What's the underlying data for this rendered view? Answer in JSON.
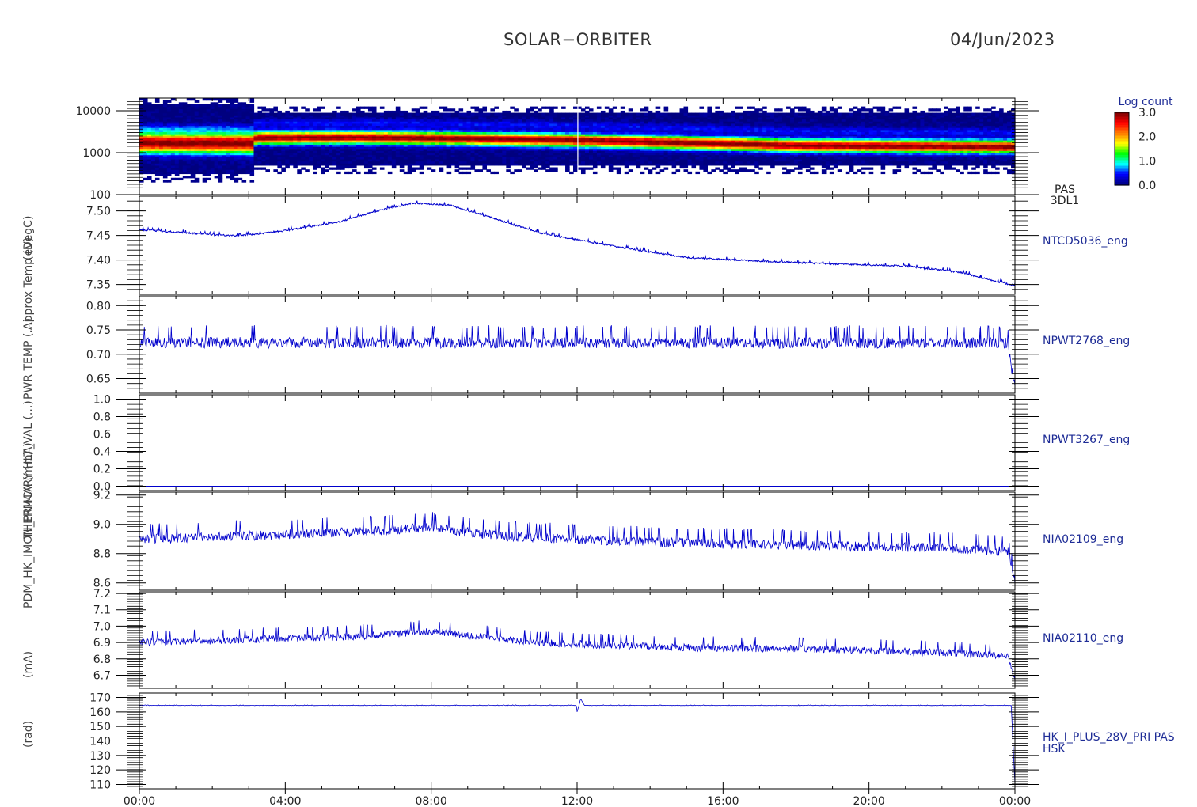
{
  "header": {
    "title": "SOLAR−ORBITER",
    "date": "04/Jun/2023"
  },
  "colors": {
    "series": "#0000cc",
    "axis": "#000000",
    "label": "#1e2c96",
    "colorbar": [
      "#00007f",
      "#0000ff",
      "#00ffff",
      "#00ff00",
      "#ffff00",
      "#ff8000",
      "#ff0000",
      "#7f0000"
    ]
  },
  "x_axis": {
    "ticks": [
      "00:00",
      "04:00",
      "08:00",
      "12:00",
      "16:00",
      "20:00",
      "00:00"
    ],
    "range_hours": [
      0,
      24
    ]
  },
  "y_title_stack": [
    "(rad)",
    "(mA)",
    "PDM_HK_IMON_PRIMARY (mA)",
    "THERMCA (m...)",
    "HLT_VAL (...)",
    "PWR TEMP (...)",
    "Approx Temp (DegC)",
    "(eV)"
  ],
  "chart_data": [
    {
      "type": "heatmap",
      "instrument_label": [
        "PAS",
        "3DL1"
      ],
      "yscale": "log",
      "ylim": [
        100,
        20000
      ],
      "yticks": [
        "100",
        "1000",
        "10000"
      ],
      "colorbar": {
        "title": "Log count",
        "ticks": [
          "3.0",
          "2.0",
          "1.0",
          "0.0"
        ],
        "range": [
          0,
          3
        ]
      },
      "peak_energy_ev": [
        {
          "x": 0.0,
          "y": 1750
        },
        {
          "x": 3.1,
          "y": 1700
        },
        {
          "x": 3.2,
          "y": 2300
        },
        {
          "x": 6.0,
          "y": 2350
        },
        {
          "x": 9.0,
          "y": 2200
        },
        {
          "x": 12.0,
          "y": 2000
        },
        {
          "x": 15.0,
          "y": 1750
        },
        {
          "x": 18.0,
          "y": 1500
        },
        {
          "x": 21.0,
          "y": 1450
        },
        {
          "x": 24.0,
          "y": 1400
        }
      ]
    },
    {
      "type": "line",
      "series_label": "NTCD5036_eng",
      "ylim": [
        7.33,
        7.53
      ],
      "yticks": [
        "7.35",
        "7.40",
        "7.45",
        "7.50"
      ],
      "noise": 0.003,
      "points": [
        {
          "x": 0,
          "y": 7.462
        },
        {
          "x": 2,
          "y": 7.452
        },
        {
          "x": 2.7,
          "y": 7.449
        },
        {
          "x": 4,
          "y": 7.46
        },
        {
          "x": 5.5,
          "y": 7.478
        },
        {
          "x": 6.5,
          "y": 7.5
        },
        {
          "x": 7.5,
          "y": 7.516
        },
        {
          "x": 8.5,
          "y": 7.512
        },
        {
          "x": 9.5,
          "y": 7.49
        },
        {
          "x": 11,
          "y": 7.455
        },
        {
          "x": 13,
          "y": 7.428
        },
        {
          "x": 15,
          "y": 7.405
        },
        {
          "x": 17,
          "y": 7.398
        },
        {
          "x": 19,
          "y": 7.392
        },
        {
          "x": 21,
          "y": 7.388
        },
        {
          "x": 22.5,
          "y": 7.375
        },
        {
          "x": 23.5,
          "y": 7.356
        },
        {
          "x": 24,
          "y": 7.348
        }
      ]
    },
    {
      "type": "line",
      "series_label": "NPWT2768_eng",
      "ylim": [
        0.62,
        0.82
      ],
      "yticks": [
        "0.65",
        "0.70",
        "0.75",
        "0.80"
      ],
      "noise": 0.02,
      "points": [
        {
          "x": 0,
          "y": 0.725
        },
        {
          "x": 23.8,
          "y": 0.724
        },
        {
          "x": 24,
          "y": 0.63
        }
      ]
    },
    {
      "type": "line",
      "series_label": "NPWT3267_eng",
      "ylim": [
        -0.05,
        1.05
      ],
      "yticks": [
        "0.0",
        "0.2",
        "0.4",
        "0.6",
        "0.8",
        "1.0"
      ],
      "noise": 0,
      "points": [
        {
          "x": 0,
          "y": 0.0
        },
        {
          "x": 24,
          "y": 0.0
        }
      ]
    },
    {
      "type": "line",
      "series_label": "NIA02109_eng",
      "ylim": [
        8.55,
        9.22
      ],
      "yticks": [
        "8.6",
        "8.8",
        "9.0",
        "9.2"
      ],
      "noise": 0.06,
      "points": [
        {
          "x": 0,
          "y": 8.9
        },
        {
          "x": 6,
          "y": 8.95
        },
        {
          "x": 8,
          "y": 8.98
        },
        {
          "x": 10,
          "y": 8.92
        },
        {
          "x": 14,
          "y": 8.88
        },
        {
          "x": 18,
          "y": 8.86
        },
        {
          "x": 22,
          "y": 8.84
        },
        {
          "x": 23.8,
          "y": 8.82
        },
        {
          "x": 24,
          "y": 8.62
        }
      ]
    },
    {
      "type": "line",
      "series_label": "NIA02110_eng",
      "ylim": [
        6.62,
        7.21
      ],
      "yticks": [
        "6.7",
        "6.8",
        "6.9",
        "7.0",
        "7.1",
        "7.2"
      ],
      "noise": 0.04,
      "points": [
        {
          "x": 0,
          "y": 6.9
        },
        {
          "x": 6,
          "y": 6.94
        },
        {
          "x": 8,
          "y": 6.97
        },
        {
          "x": 11,
          "y": 6.9
        },
        {
          "x": 15,
          "y": 6.87
        },
        {
          "x": 19,
          "y": 6.86
        },
        {
          "x": 22,
          "y": 6.84
        },
        {
          "x": 23.8,
          "y": 6.82
        },
        {
          "x": 24,
          "y": 6.67
        }
      ]
    },
    {
      "type": "line",
      "series_label": [
        "HK_I_PLUS_28V_PRI PAS",
        "HSK"
      ],
      "ylim": [
        107,
        173
      ],
      "yticks": [
        "110",
        "120",
        "130",
        "140",
        "150",
        "160",
        "170"
      ],
      "noise": 0.2,
      "points": [
        {
          "x": 0,
          "y": 164.5
        },
        {
          "x": 11.98,
          "y": 164.5
        },
        {
          "x": 12.0,
          "y": 160
        },
        {
          "x": 12.1,
          "y": 169
        },
        {
          "x": 12.2,
          "y": 164.5
        },
        {
          "x": 23.9,
          "y": 164.5
        },
        {
          "x": 24,
          "y": 110
        }
      ]
    }
  ]
}
